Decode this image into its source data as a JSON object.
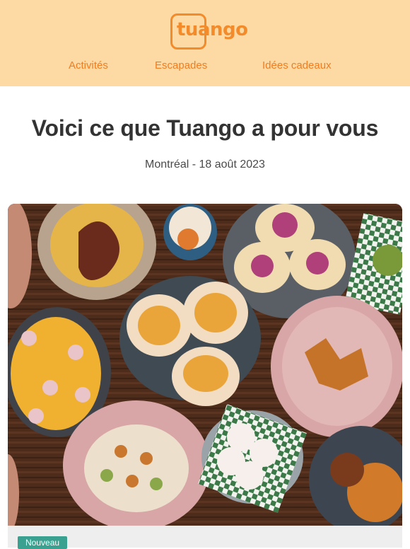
{
  "header": {
    "brand": "tuango",
    "nav": [
      {
        "label": "Activités"
      },
      {
        "label": "Escapades"
      },
      {
        "label": "Idées cadeaux"
      }
    ]
  },
  "main": {
    "title": "Voici ce que Tuango a pour vous",
    "subtitle": "Montréal - 18 août 2023",
    "badge": "Nouveau"
  },
  "colors": {
    "header_bg": "#fdd9a4",
    "accent": "#f38b2b",
    "badge": "#3aa08f"
  }
}
